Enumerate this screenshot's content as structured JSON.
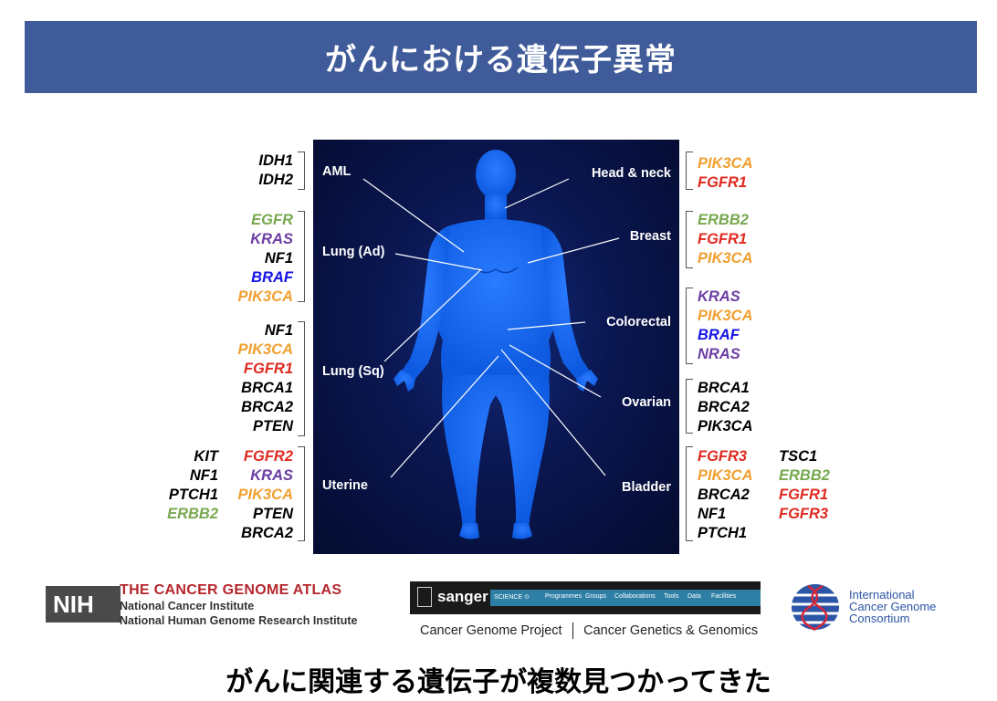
{
  "title": "がんにおける遺伝子異常",
  "organs": {
    "aml": "AML",
    "lung_ad": "Lung (Ad)",
    "lung_sq": "Lung (Sq)",
    "uterine": "Uterine",
    "head_neck": "Head & neck",
    "breast": "Breast",
    "colorectal": "Colorectal",
    "ovarian": "Ovarian",
    "bladder": "Bladder"
  },
  "gene_groups": {
    "aml": [
      {
        "gene": "IDH1",
        "color": "#000000"
      },
      {
        "gene": "IDH2",
        "color": "#000000"
      }
    ],
    "lung_ad": [
      {
        "gene": "EGFR",
        "color": "#77a84e"
      },
      {
        "gene": "KRAS",
        "color": "#6b3ea3"
      },
      {
        "gene": "NF1",
        "color": "#000000"
      },
      {
        "gene": "BRAF",
        "color": "#1414e6"
      },
      {
        "gene": "PIK3CA",
        "color": "#f0a030"
      }
    ],
    "lung_sq": [
      {
        "gene": "NF1",
        "color": "#000000"
      },
      {
        "gene": "PIK3CA",
        "color": "#f0a030"
      },
      {
        "gene": "FGFR1",
        "color": "#e02a20"
      },
      {
        "gene": "BRCA1",
        "color": "#000000"
      },
      {
        "gene": "BRCA2",
        "color": "#000000"
      },
      {
        "gene": "PTEN",
        "color": "#000000"
      }
    ],
    "uterine_col1": [
      {
        "gene": "KIT",
        "color": "#000000"
      },
      {
        "gene": "NF1",
        "color": "#000000"
      },
      {
        "gene": "PTCH1",
        "color": "#000000"
      },
      {
        "gene": "ERBB2",
        "color": "#77a84e"
      }
    ],
    "uterine_col2": [
      {
        "gene": "FGFR2",
        "color": "#e02a20"
      },
      {
        "gene": "KRAS",
        "color": "#6b3ea3"
      },
      {
        "gene": "PIK3CA",
        "color": "#f0a030"
      },
      {
        "gene": "PTEN",
        "color": "#000000"
      },
      {
        "gene": "BRCA2",
        "color": "#000000"
      }
    ],
    "head_neck": [
      {
        "gene": "PIK3CA",
        "color": "#f0a030"
      },
      {
        "gene": "FGFR1",
        "color": "#e02a20"
      }
    ],
    "breast": [
      {
        "gene": "ERBB2",
        "color": "#77a84e"
      },
      {
        "gene": "FGFR1",
        "color": "#e02a20"
      },
      {
        "gene": "PIK3CA",
        "color": "#f0a030"
      }
    ],
    "colorectal": [
      {
        "gene": "KRAS",
        "color": "#6b3ea3"
      },
      {
        "gene": "PIK3CA",
        "color": "#f0a030"
      },
      {
        "gene": "BRAF",
        "color": "#1414e6"
      },
      {
        "gene": "NRAS",
        "color": "#6b3ea3"
      }
    ],
    "ovarian": [
      {
        "gene": "BRCA1",
        "color": "#000000"
      },
      {
        "gene": "BRCA2",
        "color": "#000000"
      },
      {
        "gene": "PIK3CA",
        "color": "#000000"
      }
    ],
    "bladder_col1": [
      {
        "gene": "FGFR3",
        "color": "#e02a20"
      },
      {
        "gene": "PIK3CA",
        "color": "#f0a030"
      },
      {
        "gene": "BRCA2",
        "color": "#000000"
      },
      {
        "gene": "NF1",
        "color": "#000000"
      },
      {
        "gene": "PTCH1",
        "color": "#000000"
      }
    ],
    "bladder_col2": [
      {
        "gene": "TSC1",
        "color": "#000000"
      },
      {
        "gene": "ERBB2",
        "color": "#77a84e"
      },
      {
        "gene": "FGFR1",
        "color": "#e02a20"
      },
      {
        "gene": "FGFR3",
        "color": "#e02a20"
      }
    ]
  },
  "logos": {
    "nih": "NIH",
    "tcga_title": "THE CANCER GENOME ATLAS",
    "nci": "National Cancer Institute",
    "nhgri": "National Human Genome Research Institute",
    "sanger": "sanger",
    "sanger_nav": [
      "SCIENCE ⊙",
      "Programmes",
      "Groups",
      "Collaborations",
      "Tools",
      "Data",
      "Facilities"
    ],
    "cgp": "Cancer Genome Project",
    "cgg": "Cancer Genetics & Genomics",
    "icgc": [
      "International",
      "Cancer Genome",
      "Consortium"
    ]
  },
  "conclusion": "がんに関連する遺伝子が複数見つかってきた"
}
